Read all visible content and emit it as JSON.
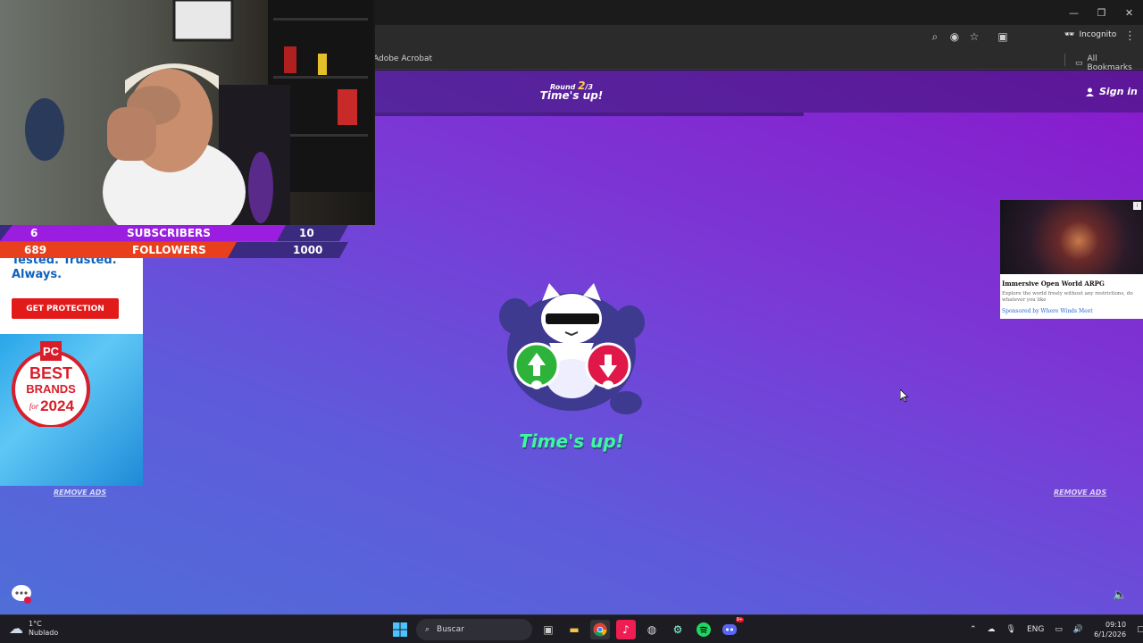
{
  "browser": {
    "incognito_label": "Incognito",
    "bookmarks": {
      "acrobat": "Adobe Acrobat",
      "all": "All Bookmarks"
    }
  },
  "game": {
    "round_prefix": "Round",
    "round_current": "2",
    "round_sep": "/",
    "round_total": "3",
    "header_status": "Time's up!",
    "sign_in": "Sign in",
    "status": "Time's up!",
    "remove_ads_left": "REMOVE ADS",
    "remove_ads_right": "REMOVE ADS"
  },
  "ad_left": {
    "headline": "Tested. Trusted. Always.",
    "cta": "GET PROTECTION",
    "badge": {
      "brand": "PC",
      "top": "BEST",
      "mid": "BRANDS",
      "for": "for",
      "year": "2024"
    }
  },
  "ad_right": {
    "title": "Immersive Open World ARPG",
    "description": "Explore the world freely without any restrictions, do whatever you like",
    "sponsor": "Sponsored by Where Winds Meet"
  },
  "stream_overlay": {
    "subscribers": {
      "current": "6",
      "label": "SUBSCRIBERS",
      "goal": "10"
    },
    "followers": {
      "current": "689",
      "label": "FOLLOWERS",
      "goal": "1000"
    }
  },
  "taskbar": {
    "weather_temp": "1°C",
    "weather_desc": "Nublado",
    "search_placeholder": "Buscar",
    "language": "ENG",
    "time": "09:10",
    "date": "6/1/2026",
    "discord_badge": "9+"
  },
  "colors": {
    "accent_green": "#3ef7a0",
    "subs_purple": "#9b1ee0",
    "followers_red": "#e8401c"
  }
}
